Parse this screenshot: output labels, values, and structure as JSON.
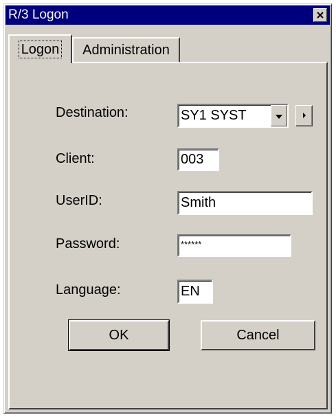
{
  "window": {
    "title": "R/3 Logon",
    "close_icon": "close-icon"
  },
  "tabs": [
    {
      "label": "Logon",
      "active": true
    },
    {
      "label": "Administration",
      "active": false
    }
  ],
  "form": {
    "destination": {
      "label": "Destination:",
      "value": "SY1 SYST"
    },
    "client": {
      "label": "Client:",
      "value": "003"
    },
    "userid": {
      "label": "UserID:",
      "value": "Smith"
    },
    "password": {
      "label": "Password:",
      "value": "******"
    },
    "language": {
      "label": "Language:",
      "value": "EN"
    }
  },
  "buttons": {
    "ok": "OK",
    "cancel": "Cancel"
  },
  "colors": {
    "title_bar": "#00007f",
    "face": "#d4d0c8"
  }
}
